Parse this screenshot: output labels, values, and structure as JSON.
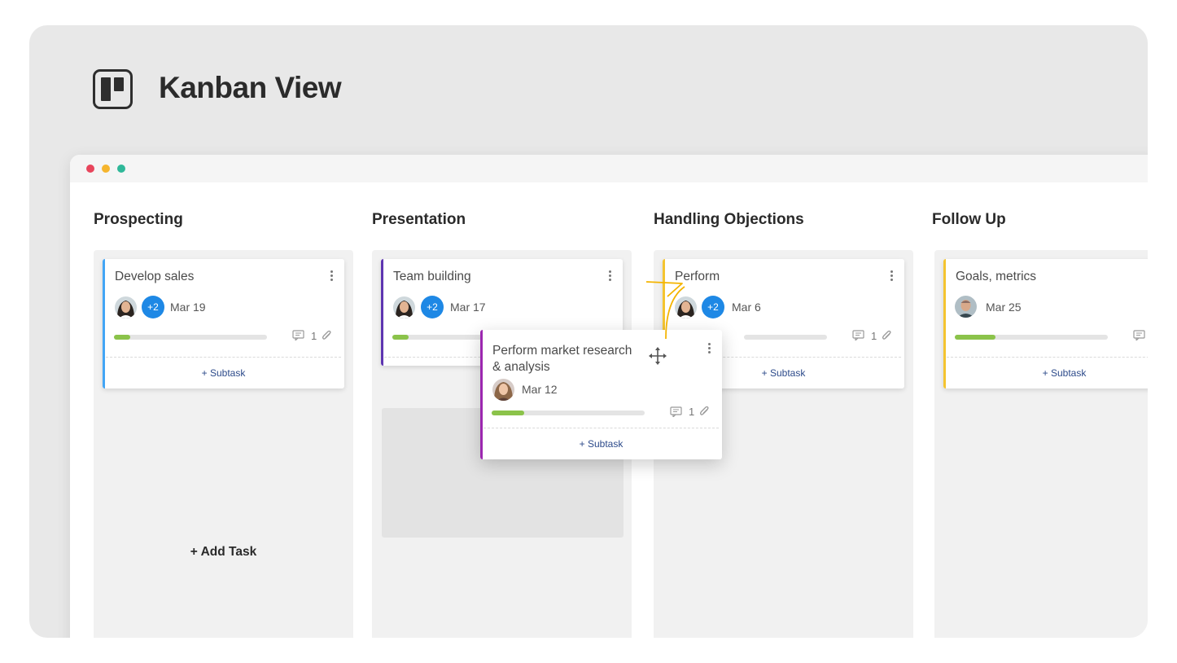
{
  "hero": {
    "title": "Kanban View",
    "icon": "kanban-board-icon"
  },
  "columns": [
    {
      "title": "Prospecting",
      "card": {
        "title": "Develop sales",
        "extra_assignees": "+2",
        "date": "Mar 19",
        "progress": 0.1,
        "comments": "1",
        "subtask": "+ Subtask",
        "stripe_color": "#42a5f5"
      },
      "add_task": "+ Add Task"
    },
    {
      "title": "Presentation",
      "card": {
        "title": "Team building",
        "extra_assignees": "+2",
        "date": "Mar 17",
        "stripe_color": "#5e35b1",
        "progress": 0.1
      }
    },
    {
      "title": "Handling Objections",
      "card": {
        "title": "Perform",
        "extra_assignees": "+2",
        "date": "Mar 6",
        "comments": "1",
        "subtask": "+ Subtask",
        "stripe_color": "#f4c430"
      }
    },
    {
      "title": "Follow Up",
      "card": {
        "title": "Goals, metrics",
        "date": "Mar 25",
        "progress": 0.27,
        "subtask": "+ Subtask",
        "stripe_color": "#f4c430"
      }
    }
  ],
  "dragged_card": {
    "title_line1": "Perform market research",
    "title_line2": "& analysis",
    "date": "Mar 12",
    "progress": 0.21,
    "comments": "1",
    "subtask": "+ Subtask",
    "stripe_color": "#9c27b0"
  },
  "colors": {
    "accent_blue": "#1e88e5",
    "progress_green": "#8bc34a",
    "arrow_yellow": "#f4b400"
  }
}
